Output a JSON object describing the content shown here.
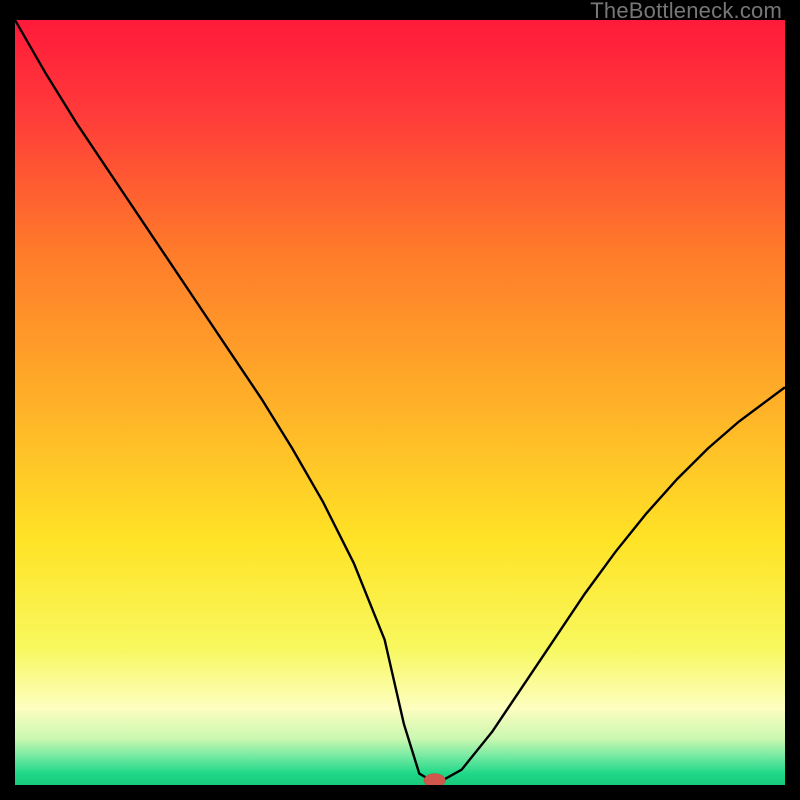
{
  "watermark": "TheBottleneck.com",
  "chart_data": {
    "type": "line",
    "title": "",
    "xlabel": "",
    "ylabel": "",
    "xlim": [
      0,
      100
    ],
    "ylim": [
      0,
      100
    ],
    "background_gradient": {
      "stops": [
        {
          "offset": 0.0,
          "color": "#ff1a3a"
        },
        {
          "offset": 0.12,
          "color": "#ff3a3a"
        },
        {
          "offset": 0.3,
          "color": "#ff7a2a"
        },
        {
          "offset": 0.5,
          "color": "#ffb028"
        },
        {
          "offset": 0.68,
          "color": "#ffe326"
        },
        {
          "offset": 0.82,
          "color": "#f8f85e"
        },
        {
          "offset": 0.9,
          "color": "#fdfec0"
        },
        {
          "offset": 0.94,
          "color": "#c9f7b0"
        },
        {
          "offset": 0.965,
          "color": "#6be8a0"
        },
        {
          "offset": 0.985,
          "color": "#1fd887"
        },
        {
          "offset": 1.0,
          "color": "#18c97c"
        }
      ]
    },
    "series": [
      {
        "name": "bottleneck-curve",
        "stroke": "#000000",
        "stroke_width": 2.4,
        "x": [
          0.0,
          4,
          8,
          12,
          16,
          20,
          24,
          28,
          32,
          36,
          40,
          44,
          48,
          50.5,
          52.5,
          54,
          55.5,
          58,
          62,
          66,
          70,
          74,
          78,
          82,
          86,
          90,
          94,
          98,
          100
        ],
        "y": [
          100,
          93,
          86.5,
          80.5,
          74.5,
          68.5,
          62.5,
          56.5,
          50.5,
          44.0,
          37.0,
          29.0,
          19.0,
          8.0,
          1.5,
          0.6,
          0.6,
          2.0,
          7.0,
          13.0,
          19.0,
          25.0,
          30.5,
          35.5,
          40.0,
          44.0,
          47.5,
          50.5,
          52.0
        ]
      }
    ],
    "marker": {
      "name": "optimal-point",
      "x": 54.5,
      "y": 0.6,
      "rx": 1.4,
      "ry": 0.9,
      "fill": "#d1564b",
      "stroke": "#a8382e"
    }
  }
}
